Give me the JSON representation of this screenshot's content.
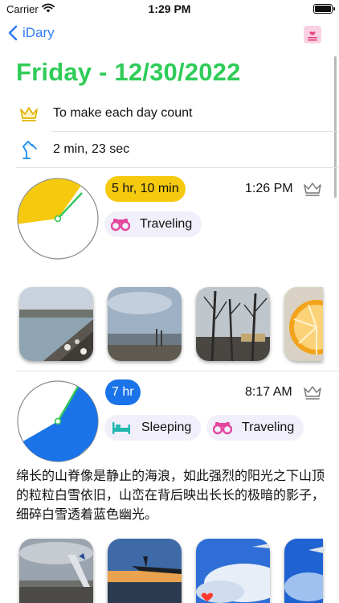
{
  "status_bar": {
    "carrier": "Carrier",
    "time": "1:29 PM"
  },
  "nav": {
    "back_label": "iDary"
  },
  "day": {
    "title": "Friday - 12/30/2022",
    "motto": "To make each day count",
    "session_time": "2 min, 23 sec"
  },
  "entries": [
    {
      "duration": "5 hr, 10 min",
      "badge_color": "#f5c90e",
      "badge_text_color": "#111111",
      "time": "1:26 PM",
      "tags": [
        {
          "label": "Traveling",
          "icon": "binoculars-icon"
        }
      ],
      "photos": [
        "frozen-shoreline-photo",
        "lake-shore-photo",
        "bare-trees-photo",
        "orange-slices-photo"
      ]
    },
    {
      "duration": "7 hr",
      "badge_color": "#1a73e8",
      "badge_text_color": "#ffffff",
      "time": "8:17 AM",
      "tags": [
        {
          "label": "Sleeping",
          "icon": "bed-icon"
        },
        {
          "label": "Traveling",
          "icon": "binoculars-icon"
        }
      ],
      "note": "绵长的山脊像是静止的海浪，如此强烈的阳光之下山顶的粒粒白雪依旧，山峦在背后映出长长的极暗的影子，细碎白雪透着蓝色幽光。",
      "photos": [
        "airport-tarmac-photo",
        "airplane-wing-sunset-photo",
        "clouds-from-plane-photo",
        "blue-sky-wing-photo"
      ]
    }
  ],
  "colors": {
    "title_green": "#2fcc58",
    "accent_blue": "#2f7cf6",
    "tag_bg": "#f0effa"
  }
}
